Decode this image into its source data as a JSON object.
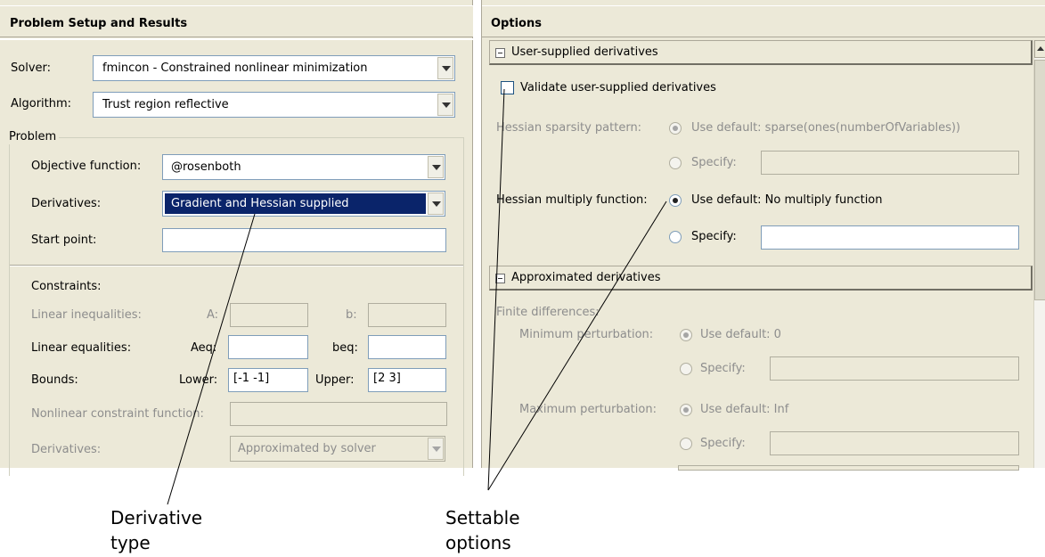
{
  "left_panel": {
    "title": "Problem Setup and Results",
    "solver_label": "Solver:",
    "solver_value": "fmincon - Constrained nonlinear minimization",
    "algorithm_label": "Algorithm:",
    "algorithm_value": "Trust region reflective",
    "problem_group": "Problem",
    "objective_label": "Objective function:",
    "objective_value": "@rosenboth",
    "derivatives_label": "Derivatives:",
    "derivatives_value": "Gradient and Hessian supplied",
    "start_point_label": "Start point:",
    "start_point_value": "",
    "constraints_label": "Constraints:",
    "lin_ineq_label": "Linear inequalities:",
    "a_label": "A:",
    "b_label": "b:",
    "lin_eq_label": "Linear equalities:",
    "aeq_label": "Aeq:",
    "beq_label": "beq:",
    "bounds_label": "Bounds:",
    "lower_label": "Lower:",
    "lower_value": "[-1 -1]",
    "upper_label": "Upper:",
    "upper_value": "[2 3]",
    "nonlin_label": "Nonlinear constraint function:",
    "nl_derivatives_label": "Derivatives:",
    "nl_derivatives_value": "Approximated by solver"
  },
  "right_panel": {
    "title": "Options",
    "user_section": "User-supplied derivatives",
    "validate_label": "Validate user-supplied derivatives",
    "hess_sparsity_label": "Hessian sparsity pattern:",
    "hess_sparsity_default": "Use default: sparse(ones(numberOfVariables))",
    "specify_label": "Specify:",
    "hess_mult_label": "Hessian multiply function:",
    "hess_mult_default": "Use default: No multiply function",
    "approx_section": "Approximated derivatives",
    "finite_diff_label": "Finite differences:",
    "min_pert_label": "Minimum perturbation:",
    "min_pert_default": "Use default: 0",
    "max_pert_label": "Maximum perturbation:",
    "max_pert_default": "Use default: Inf"
  },
  "captions": {
    "derivative_type": [
      "Derivative",
      "type"
    ],
    "settable_options": [
      "Settable",
      "options"
    ]
  },
  "colors": {
    "panel_bg": "#ece9d8",
    "selection": "#0a246a",
    "disabled_text": "#8d8d8d"
  }
}
